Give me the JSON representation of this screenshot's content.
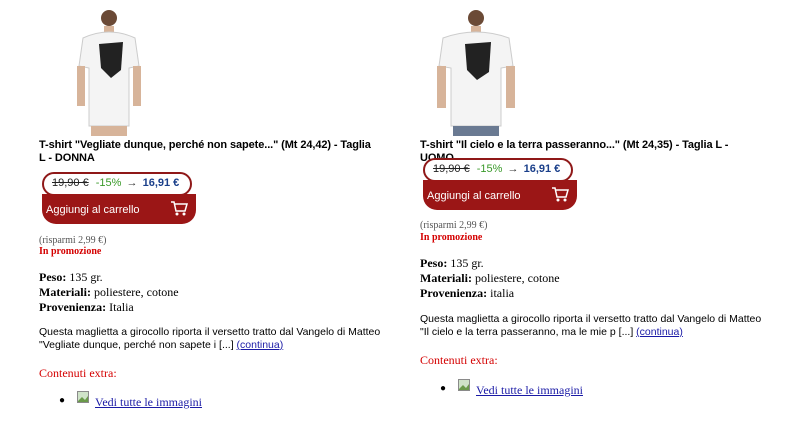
{
  "products": [
    {
      "title": "T-shirt \"Vegliate dunque, perché non sapete...\" (Mt 24,42) - Taglia L - DONNA",
      "old_price": "19,90 €",
      "discount": "-15%",
      "arrow": "→",
      "new_price": "16,91 €",
      "cart_label": "Aggiungi al carrello",
      "savings": "(risparmi 2,99 €)",
      "promo": "In promozione",
      "weight_label": "Peso:",
      "weight": "135 gr.",
      "materials_label": "Materiali:",
      "materials": "poliestere, cotone",
      "origin_label": "Provenienza:",
      "origin": "Italia",
      "description": "Questa maglietta a girocollo riporta il versetto tratto dal Vangelo di Matteo \"Vegliate dunque, perché non sapete i [...] ",
      "more_link": "(continua)",
      "extra_heading": "Contenuti extra:",
      "gallery_link": "Vedi tutte le immagini"
    },
    {
      "title": "T-shirt \"Il cielo e la terra passeranno...\" (Mt 24,35) - Taglia L - UOMO",
      "old_price": "19,90 €",
      "discount": "-15%",
      "arrow": "→",
      "new_price": "16,91 €",
      "cart_label": "Aggiungi al carrello",
      "savings": "(risparmi 2,99 €)",
      "promo": "In promozione",
      "weight_label": "Peso:",
      "weight": "135 gr.",
      "materials_label": "Materiali:",
      "materials": "poliestere, cotone",
      "origin_label": "Provenienza:",
      "origin": "italia",
      "description": "Questa maglietta a girocollo riporta il versetto tratto dal Vangelo di Matteo \"Il cielo e la terra passeranno, ma le mie p [...] ",
      "more_link": "(continua)",
      "extra_heading": "Contenuti extra:",
      "gallery_link": "Vedi tutte le immagini"
    }
  ],
  "colors": {
    "cart_red": "#9b1616",
    "discount_green": "#3a9a2a",
    "price_blue": "#1a3f8a",
    "promo_red": "#d40000",
    "link_blue": "#1a1aa6"
  },
  "icons": [
    "tshirt-woman-photo",
    "tshirt-man-photo",
    "shopping-cart-icon",
    "image-icon"
  ]
}
